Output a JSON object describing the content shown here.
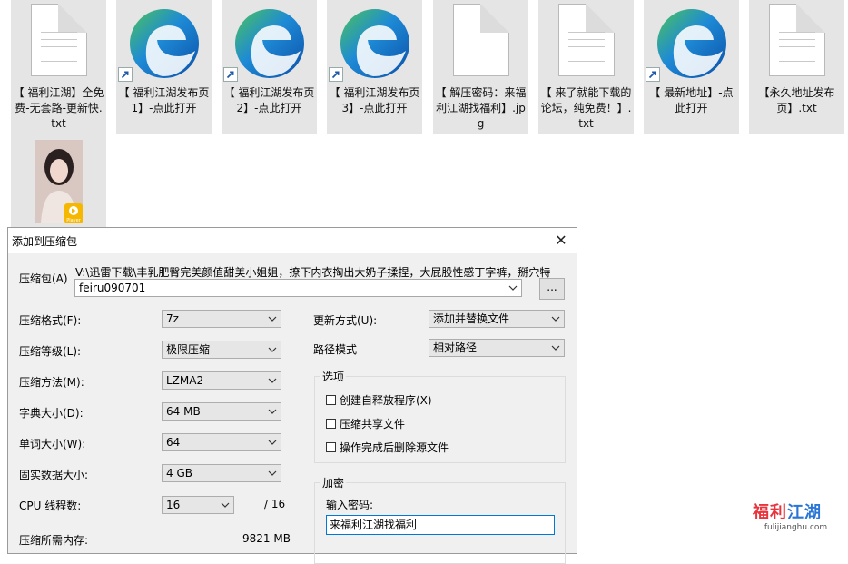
{
  "desktop": {
    "icons": [
      {
        "label": "【 福利江湖】全免费-无套路-更新快.txt",
        "type": "text-file"
      },
      {
        "label": "【 福利江湖发布页1】-点此打开",
        "type": "edge-shortcut"
      },
      {
        "label": "【 福利江湖发布页2】-点此打开",
        "type": "edge-shortcut"
      },
      {
        "label": "【 福利江湖发布页3】-点此打开",
        "type": "edge-shortcut"
      },
      {
        "label": "【 解压密码：来福利江湖找福利】.jpg",
        "type": "image-file"
      },
      {
        "label": "【 来了就能下载的论坛，纯免费！】.txt",
        "type": "text-file"
      },
      {
        "label": "【 最新地址】-点此打开",
        "type": "edge-shortcut"
      },
      {
        "label": "【永久地址发布页】.txt",
        "type": "text-file"
      },
      {
        "label": "",
        "type": "video-file"
      }
    ],
    "video_badge": "Player"
  },
  "dialog": {
    "title": "添加到压缩包",
    "close_glyph": "✕",
    "archive_label": "压缩包(A)",
    "archive_path": "V:\\迅雷下载\\丰乳肥臀完美颜值甜美小姐姐，撩下内衣掏出大奶子揉捏，大屁股性感丁字裤，掰穴特",
    "archive_name": "feiru090701",
    "browse_label": "...",
    "left_fields": [
      {
        "label": "压缩格式(F):",
        "value": "7z"
      },
      {
        "label": "压缩等级(L):",
        "value": "极限压缩"
      },
      {
        "label": "压缩方法(M):",
        "value": "LZMA2"
      },
      {
        "label": "字典大小(D):",
        "value": "64 MB"
      },
      {
        "label": "单词大小(W):",
        "value": "64"
      },
      {
        "label": "固实数据大小:",
        "value": "4 GB"
      }
    ],
    "cpu_label": "CPU 线程数:",
    "cpu_value": "16",
    "cpu_total": "/ 16",
    "memory_label": "压缩所需内存:",
    "memory_value": "9821 MB",
    "update_label": "更新方式(U):",
    "update_value": "添加并替换文件",
    "pathmode_label": "路径模式",
    "pathmode_value": "相对路径",
    "options_title": "选项",
    "options": [
      {
        "label": "创建自释放程序(X)",
        "checked": false
      },
      {
        "label": "压缩共享文件",
        "checked": false
      },
      {
        "label": "操作完成后删除源文件",
        "checked": false
      }
    ],
    "encrypt_title": "加密",
    "password_label": "输入密码:",
    "password_value": "来福利江湖找福利"
  },
  "watermark": {
    "cn_a": "福利",
    "cn_b": "江湖",
    "url": "fulijianghu.com"
  },
  "colors": {
    "tile_bg": "#e5e5e5",
    "dialog_bg": "#f0f0f0",
    "focus": "#0078d7",
    "edge_blue": "#1e8ad6",
    "edge_green": "#4cc35a"
  }
}
